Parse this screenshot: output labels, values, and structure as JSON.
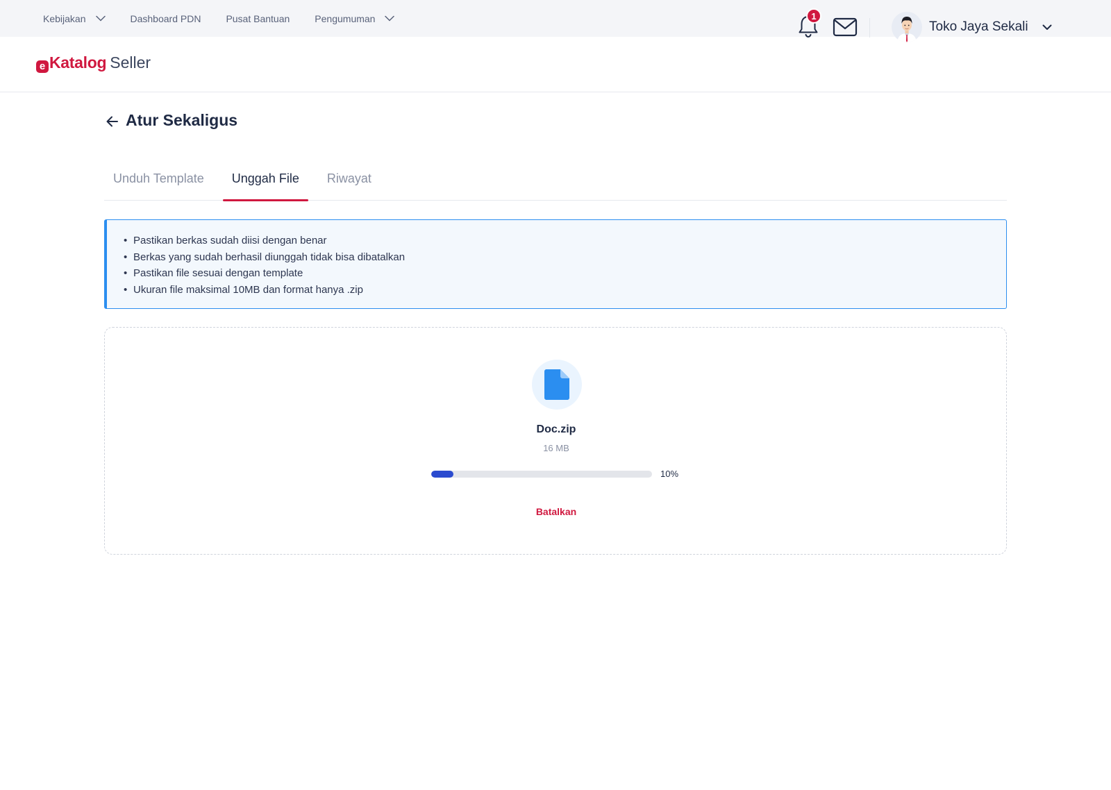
{
  "topbar": {
    "items": [
      {
        "label": "Kebijakan",
        "has_dropdown": true
      },
      {
        "label": "Dashboard PDN",
        "has_dropdown": false
      },
      {
        "label": "Pusat Bantuan",
        "has_dropdown": false
      },
      {
        "label": "Pengumuman",
        "has_dropdown": true
      }
    ]
  },
  "header": {
    "logo": {
      "mark": "e",
      "name": "Katalog",
      "suffix": "Seller"
    },
    "notification_count": "1",
    "user_name": "Toko Jaya Sekali"
  },
  "page": {
    "title": "Atur Sekaligus"
  },
  "tabs": [
    {
      "label": "Unduh Template",
      "active": false
    },
    {
      "label": "Unggah File",
      "active": true
    },
    {
      "label": "Riwayat",
      "active": false
    }
  ],
  "info": {
    "items": [
      "Pastikan berkas sudah diisi dengan benar",
      "Berkas yang sudah berhasil diunggah tidak bisa dibatalkan",
      "Pastikan file sesuai dengan template",
      "Ukuran file maksimal 10MB dan format hanya .zip"
    ]
  },
  "upload": {
    "file_name": "Doc.zip",
    "file_size": "16 MB",
    "progress_percent": 10,
    "progress_label": "10%",
    "cancel_label": "Batalkan"
  },
  "colors": {
    "brand": "#d0183f",
    "info_border": "#2b8ef0",
    "progress": "#2b4bcf",
    "file_icon": "#2b8ef0"
  },
  "icons": {
    "topbar_dropdown": "chevron-down-icon",
    "notifications": "bell-icon",
    "messages": "mail-icon",
    "back": "arrow-left-icon",
    "file": "file-icon"
  }
}
